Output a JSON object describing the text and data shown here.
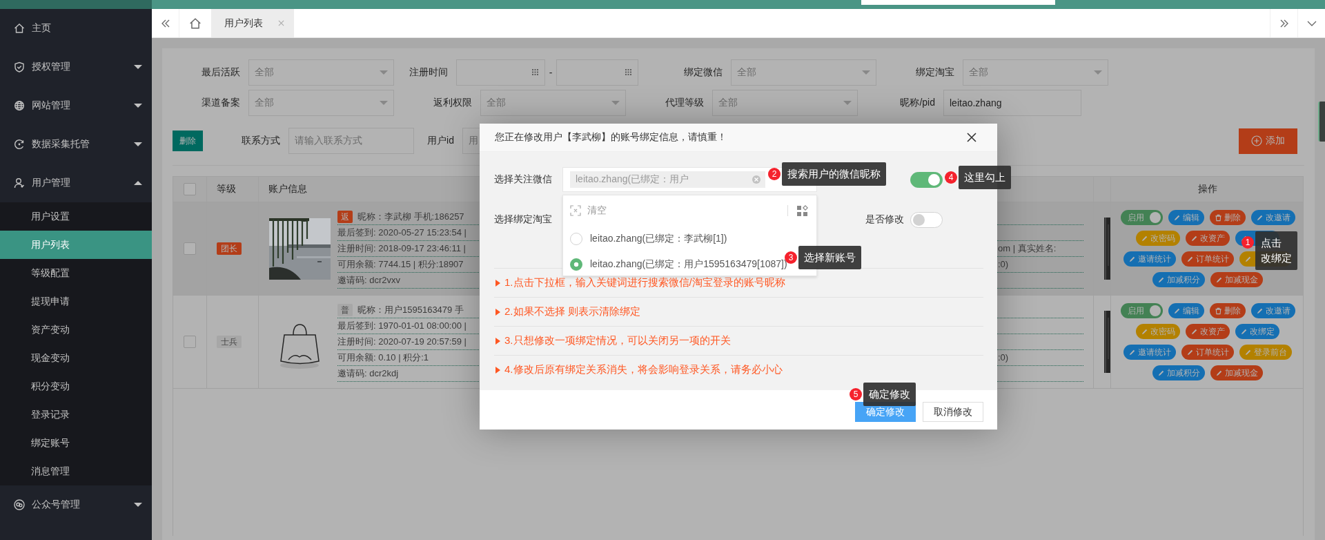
{
  "sidebar": {
    "items": [
      {
        "label": "主页"
      },
      {
        "label": "授权管理",
        "expanded": false
      },
      {
        "label": "网站管理",
        "expanded": false
      },
      {
        "label": "数据采集托管",
        "expanded": false
      },
      {
        "label": "用户管理",
        "expanded": true,
        "children": [
          {
            "label": "用户设置",
            "selected": false
          },
          {
            "label": "用户列表",
            "selected": true
          },
          {
            "label": "等级配置",
            "selected": false
          },
          {
            "label": "提现申请",
            "selected": false
          },
          {
            "label": "资产变动",
            "selected": false
          },
          {
            "label": "现金变动",
            "selected": false
          },
          {
            "label": "积分变动",
            "selected": false
          },
          {
            "label": "登录记录",
            "selected": false
          },
          {
            "label": "绑定账号",
            "selected": false
          },
          {
            "label": "消息管理",
            "selected": false
          }
        ]
      },
      {
        "label": "公众号管理",
        "expanded": false
      }
    ]
  },
  "tabs": [
    {
      "label": "用户列表",
      "selected": true
    }
  ],
  "filters": {
    "rows": [
      {
        "fields": [
          {
            "kind": "select",
            "label": "最后活跃",
            "placeholder": "全部"
          },
          {
            "kind": "daterange",
            "label": "注册时间",
            "separator": "-"
          },
          {
            "kind": "select",
            "label": "绑定微信",
            "placeholder": "全部"
          },
          {
            "kind": "select",
            "label": "绑定淘宝",
            "placeholder": "全部"
          }
        ]
      },
      {
        "fields": [
          {
            "kind": "select",
            "label": "渠道备案",
            "placeholder": "全部"
          },
          {
            "kind": "select",
            "label": "返利权限",
            "placeholder": "全部"
          },
          {
            "kind": "select",
            "label": "代理等级",
            "placeholder": "全部"
          },
          {
            "kind": "input",
            "label": "昵称/pid",
            "value": "leitao.zhang"
          }
        ]
      }
    ],
    "delete_button": "删除",
    "search": [
      {
        "label": "联系方式",
        "placeholder": "请输入联系方式"
      },
      {
        "label": "用户id",
        "placeholder": "用"
      }
    ],
    "add_button": "添加"
  },
  "table": {
    "select_all": {
      "checked": false
    },
    "columns": [
      {
        "label": "等级"
      },
      {
        "label": "账户信息"
      },
      {
        "label": "操作"
      }
    ],
    "rows": [
      {
        "checked": false,
        "highlighted": true,
        "level": {
          "text": "团长",
          "color": "#b33d18"
        },
        "avatar": {
          "kind": "picture"
        },
        "info": [
          {
            "tag": {
              "text": "返",
              "color": "#b33d18"
            },
            "text": "昵称：李武柳  手机:186257"
          },
          {
            "text": "最后签到: 2020-05-27 15:23:54 |"
          },
          {
            "text": "注册时间: 2018-09-17 23:46:11 |",
            "tail": "om | 真实姓名:"
          },
          {
            "text": "可用余额: 7744.15 | 积分:18907",
            "tail": ":0)"
          },
          {
            "text": "邀请码: dcr2vxv"
          }
        ],
        "actions": [
          {
            "kind": "switch",
            "label": "启用",
            "on": true
          },
          {
            "kind": "edit",
            "label": "编辑",
            "color": "#156fb2"
          },
          {
            "kind": "delete",
            "label": "删除",
            "color": "#b33d18"
          },
          {
            "kind": "edit",
            "label": "改邀请",
            "color": "#156fb2"
          },
          {
            "kind": "edit",
            "label": "改密码",
            "color": "#b38100"
          },
          {
            "kind": "edit",
            "label": "改资产",
            "color": "#b33d18"
          },
          {
            "kind": "edit",
            "color": "#156fb2"
          },
          {
            "kind": "edit",
            "label": "邀请统计",
            "color": "#156fb2"
          },
          {
            "kind": "edit",
            "label": "订单统计",
            "color": "#b33d18"
          },
          {
            "kind": "edit",
            "color": "#b38100"
          },
          {
            "kind": "edit",
            "label": "加减积分",
            "color": "#156fb2"
          },
          {
            "kind": "edit",
            "label": "加减现金",
            "color": "#b33d18"
          }
        ]
      },
      {
        "checked": false,
        "highlighted": false,
        "level": {
          "text": "士兵",
          "color": "#a7a7a7"
        },
        "avatar": {
          "kind": "drawing"
        },
        "info": [
          {
            "tag": {
              "text": "普",
              "color": "#a7a7a7"
            },
            "text": "昵称：用户1595163479 手"
          },
          {
            "text": "最后签到: 1970-01-01 08:00:00 |"
          },
          {
            "text": "注册时间: 2020-07-19 20:57:59 |"
          },
          {
            "text": "可用余额: 0.10 | 积分:1",
            "tail": ":0)"
          },
          {
            "text": "邀请码: dcr2kdj"
          }
        ],
        "actions": [
          {
            "kind": "switch",
            "label": "启用",
            "on": true
          },
          {
            "kind": "edit",
            "label": "编辑",
            "color": "#156fb2"
          },
          {
            "kind": "delete",
            "label": "删除",
            "color": "#b33d18"
          },
          {
            "kind": "edit",
            "label": "改邀请",
            "color": "#156fb2"
          },
          {
            "kind": "edit",
            "label": "改密码",
            "color": "#b38100"
          },
          {
            "kind": "edit",
            "label": "改资产",
            "color": "#b33d18"
          },
          {
            "kind": "edit",
            "label": "改绑定",
            "color": "#156fb2"
          },
          {
            "kind": "edit",
            "label": "邀请统计",
            "color": "#156fb2"
          },
          {
            "kind": "edit",
            "label": "订单统计",
            "color": "#b33d18"
          },
          {
            "kind": "edit",
            "label": "登录前台",
            "color": "#b38100"
          },
          {
            "kind": "edit",
            "label": "加减积分",
            "color": "#156fb2"
          },
          {
            "kind": "edit",
            "label": "加减现金",
            "color": "#b33d18"
          }
        ]
      }
    ]
  },
  "modal": {
    "title": "您正在修改用户【李武柳】的账号绑定信息，请慎重！",
    "fields": [
      {
        "label": "选择关注微信",
        "chip": "leitao.zhang(已绑定：用户",
        "switch": {
          "on": true
        }
      },
      {
        "label": "选择绑定淘宝",
        "switch": {
          "label": "是否修改",
          "on": false
        }
      }
    ],
    "dropdown": {
      "clear": "清空",
      "options": [
        {
          "label": "leitao.zhang(已绑定：李武柳[1])",
          "selected": false
        },
        {
          "label": "leitao.zhang(已绑定：用户1595163479[1087])",
          "selected": true
        }
      ]
    },
    "tips": [
      "1.点击下拉框，输入关键词进行搜索微信/淘宝登录的账号昵称",
      "2.如果不选择 则表示清除绑定",
      "3.只想修改一项绑定情况，可以关闭另一项的开关",
      "4.修改后原有绑定关系消失，将会影响登录关系，请务必小心"
    ],
    "buttons": [
      {
        "label": "确定修改",
        "kind": "primary"
      },
      {
        "label": "取消修改",
        "kind": "default"
      }
    ]
  },
  "annotations": [
    {
      "number": "1",
      "lines": [
        "点击",
        "改绑定"
      ]
    },
    {
      "number": "2",
      "lines": [
        "搜索用户的微信昵称"
      ]
    },
    {
      "number": "3",
      "lines": [
        "选择新账号"
      ]
    },
    {
      "number": "4",
      "lines": [
        "这里勾上"
      ]
    },
    {
      "number": "5",
      "lines": [
        "确定修改"
      ]
    }
  ]
}
